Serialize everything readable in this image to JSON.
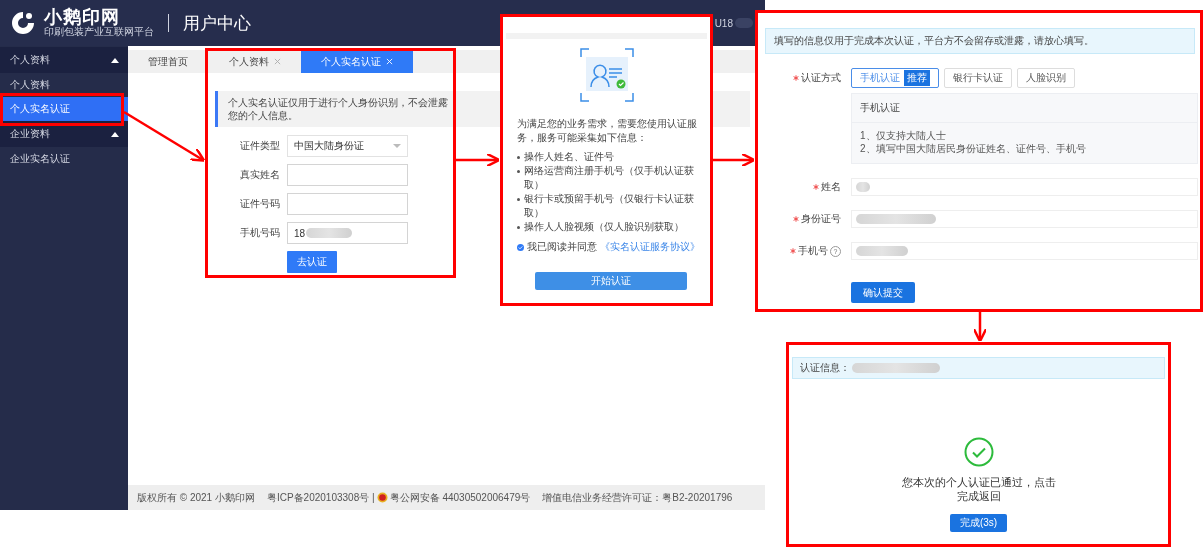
{
  "header": {
    "brand": "小鹅印网",
    "tagline": "印刷包装产业互联网平台",
    "title": "用户中心",
    "user": "U18",
    "user_redacted": true
  },
  "sidebar": {
    "groups": [
      {
        "label": "个人资料",
        "expanded": true,
        "items": [
          {
            "label": "个人资料",
            "selected": false
          },
          {
            "label": "个人实名认证",
            "selected": true
          }
        ]
      },
      {
        "label": "企业资料",
        "expanded": true,
        "items": [
          {
            "label": "企业实名认证",
            "selected": false
          }
        ]
      }
    ]
  },
  "tabs": [
    {
      "label": "管理首页",
      "closable": false,
      "selected": false
    },
    {
      "label": "个人资料",
      "closable": true,
      "selected": false
    },
    {
      "label": "个人实名认证",
      "closable": true,
      "selected": true
    }
  ],
  "identity_form": {
    "notice": "个人实名认证仅用于进行个人身份识别，不会泄露您的个人信息。",
    "fields": [
      {
        "label": "证件类型",
        "kind": "select",
        "value": "中国大陆身份证"
      },
      {
        "label": "真实姓名",
        "kind": "input",
        "redacted": false
      },
      {
        "label": "证件号码",
        "kind": "input",
        "redacted": false
      },
      {
        "label": "手机号码",
        "kind": "input",
        "value": "18",
        "redacted": true
      }
    ],
    "submit": "去认证"
  },
  "footer": {
    "copyright": "版权所有 © 2021 小鹅印网",
    "icp": "粤ICP备2020103308号 |",
    "police": "粤公网安备 44030502006479号",
    "license": "增值电信业务经营许可证：粤B2-20201796"
  },
  "consent_panel": {
    "intro": "为满足您的业务需求，需要您使用认证服务，服务可能采集如下信息：",
    "items": [
      "操作人姓名、证件号",
      "网络运营商注册手机号（仅手机认证获取）",
      "银行卡或预留手机号（仅银行卡认证获取）",
      "操作人人脸视频（仅人脸识别获取）"
    ],
    "agreement": {
      "checked": true,
      "text": "我已阅读并同意",
      "link": "《实名认证服务协议》"
    },
    "button": "开始认证"
  },
  "verify_panel": {
    "notice": "填写的信息仅用于完成本次认证，平台方不会留存或泄露，请放心填写。",
    "method_label": "认证方式",
    "method_required": true,
    "methods": [
      {
        "label": "手机认证",
        "badge": "推荐",
        "selected": true
      },
      {
        "label": "银行卡认证",
        "selected": false
      },
      {
        "label": "人脸识别",
        "selected": false
      }
    ],
    "info": {
      "title": "手机认证",
      "lines": [
        "1、仅支持大陆人士",
        "2、填写中国大陆居民身份证姓名、证件号、手机号"
      ]
    },
    "fields": [
      {
        "label": "姓名",
        "required": true,
        "redacted": true
      },
      {
        "label": "身份证号",
        "required": true,
        "redacted": true
      },
      {
        "label": "手机号",
        "required": true,
        "help": "?",
        "redacted": true
      }
    ],
    "button": "确认提交"
  },
  "result_panel": {
    "notice_label": "认证信息：",
    "notice_redacted": true,
    "message": "您本次的个人认证已通过，点击完成返回",
    "button": "完成(3s)"
  }
}
